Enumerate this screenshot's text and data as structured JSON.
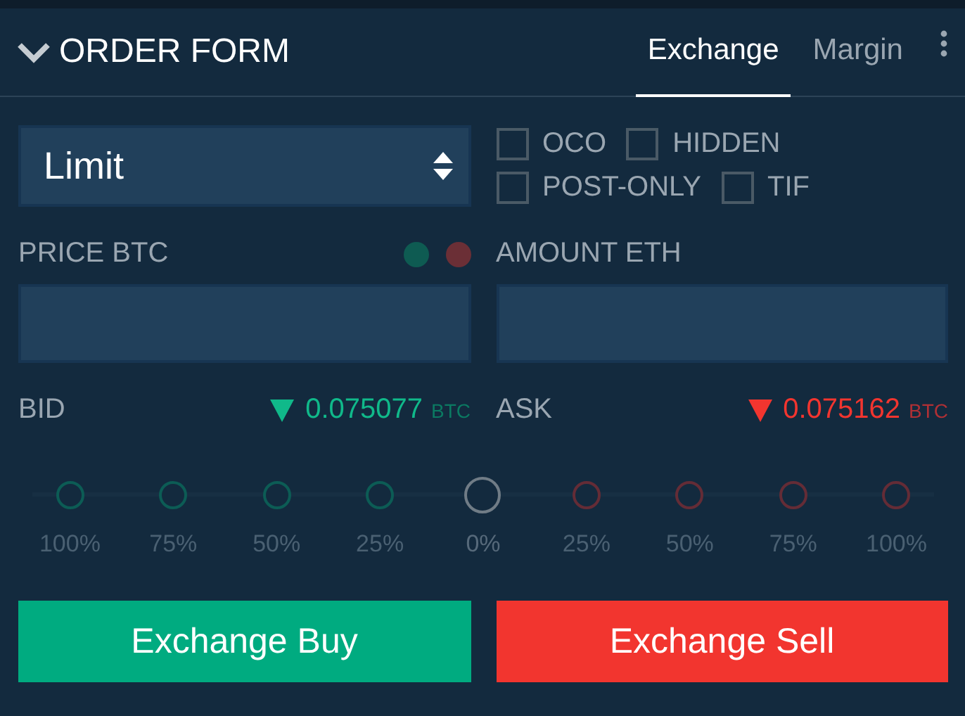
{
  "header": {
    "title": "ORDER FORM",
    "expanded": true,
    "tabs": [
      {
        "label": "Exchange",
        "selected": true
      },
      {
        "label": "Margin",
        "selected": false
      }
    ]
  },
  "order_type": {
    "value": "Limit"
  },
  "options": [
    {
      "label": "OCO",
      "checked": false
    },
    {
      "label": "HIDDEN",
      "checked": false
    },
    {
      "label": "POST-ONLY",
      "checked": false
    },
    {
      "label": "TIF",
      "checked": false
    }
  ],
  "price": {
    "label": "PRICE BTC",
    "dots": [
      {
        "color": "#0e5b52"
      },
      {
        "color": "#6b2f36"
      }
    ]
  },
  "amount": {
    "label": "AMOUNT ETH"
  },
  "quotes": [
    {
      "label": "BID",
      "kind": "bid",
      "value": "0.075077",
      "unit": "BTC"
    },
    {
      "label": "ASK",
      "kind": "ask",
      "value": "0.075162",
      "unit": "BTC"
    }
  ],
  "slider": [
    {
      "label": "100%",
      "kind": "buy",
      "selected": false
    },
    {
      "label": "75%",
      "kind": "buy",
      "selected": false
    },
    {
      "label": "50%",
      "kind": "buy",
      "selected": false
    },
    {
      "label": "25%",
      "kind": "buy",
      "selected": false
    },
    {
      "label": "0%",
      "kind": "neutral",
      "selected": true
    },
    {
      "label": "25%",
      "kind": "sell",
      "selected": false
    },
    {
      "label": "50%",
      "kind": "sell",
      "selected": false
    },
    {
      "label": "75%",
      "kind": "sell",
      "selected": false
    },
    {
      "label": "100%",
      "kind": "sell",
      "selected": false
    }
  ],
  "buttons": [
    {
      "label": "Exchange Buy",
      "kind": "buy"
    },
    {
      "label": "Exchange Sell",
      "kind": "sell"
    }
  ]
}
